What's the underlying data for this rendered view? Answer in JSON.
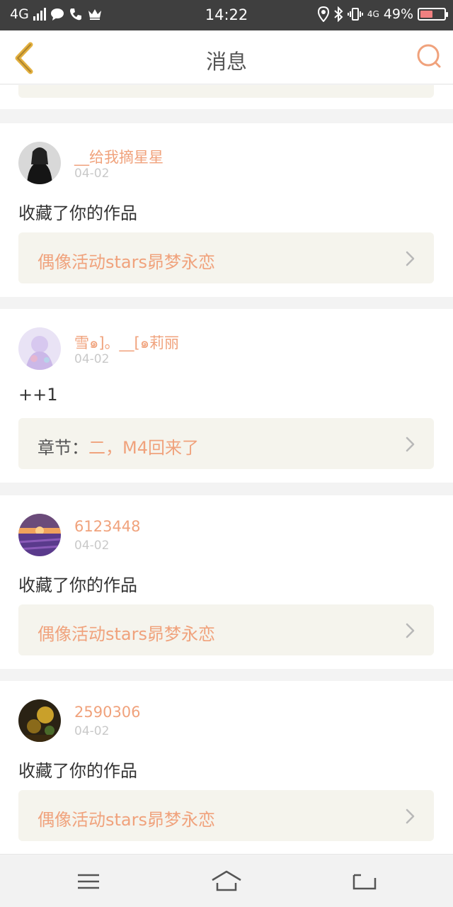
{
  "status_bar": {
    "network": "4G",
    "time": "14:22",
    "network2": "4G",
    "battery": "49%"
  },
  "header": {
    "title": "消息"
  },
  "messages": [
    {
      "username": "__给我摘星星",
      "date": "04-02",
      "text": "收藏了你的作品",
      "link_prefix": "",
      "link_text": "偶像活动stars昴梦永恋"
    },
    {
      "username": "雪๑]。__[๑莉丽",
      "date": "04-02",
      "text": "++1",
      "link_prefix": "章节：",
      "link_text": "二，M4回来了"
    },
    {
      "username": "6123448",
      "date": "04-02",
      "text": "收藏了你的作品",
      "link_prefix": "",
      "link_text": "偶像活动stars昴梦永恋"
    },
    {
      "username": "2590306",
      "date": "04-02",
      "text": "收藏了你的作品",
      "link_prefix": "",
      "link_text": "偶像活动stars昴梦永恋"
    }
  ],
  "colors": {
    "accent": "#f0a27c",
    "link_bg": "#f5f4ed",
    "status_bar": "#3f3f3f"
  }
}
